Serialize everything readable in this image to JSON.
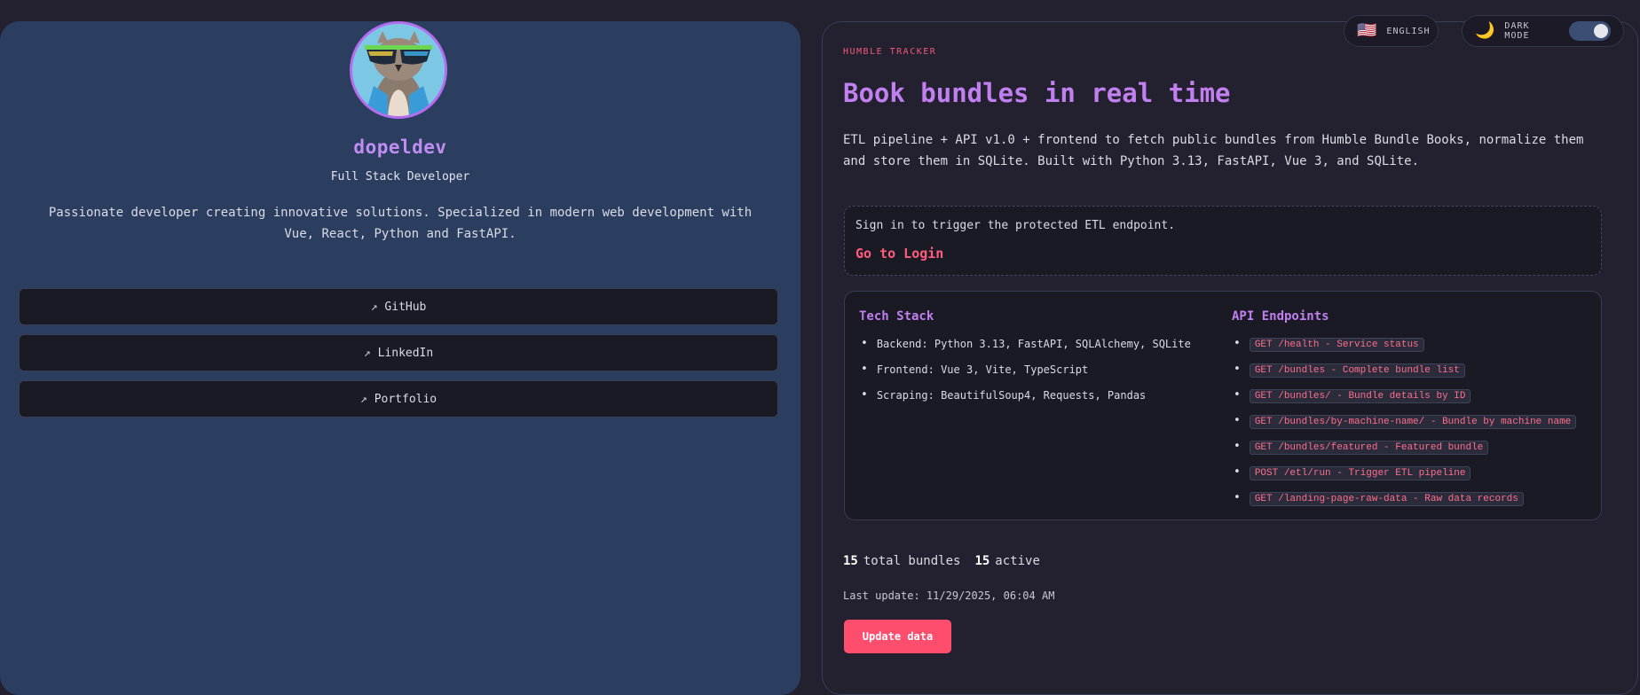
{
  "profile": {
    "name": "dopeldev",
    "role": "Full Stack Developer",
    "bio": "Passionate developer creating innovative solutions. Specialized in modern web development with Vue, React, Python and FastAPI.",
    "links": [
      {
        "label": "GitHub",
        "icon": "external-arrow-icon"
      },
      {
        "label": "LinkedIn",
        "icon": "external-arrow-icon"
      },
      {
        "label": "Portfolio",
        "icon": "external-arrow-icon"
      }
    ],
    "link_arrow": "↗"
  },
  "header": {
    "language_flag": "🇺🇸",
    "language_label": "ENGLISH",
    "theme_icon": "🌙",
    "theme_label": "DARK MODE",
    "dark_mode_on": true
  },
  "hero": {
    "eyebrow": "HUMBLE TRACKER",
    "title": "Book bundles in real time",
    "description": "ETL pipeline + API v1.0 + frontend to fetch public bundles from Humble Bundle Books, normalize them and store them in SQLite. Built with Python 3.13, FastAPI, Vue 3, and SQLite."
  },
  "login": {
    "message": "Sign in to trigger the protected ETL endpoint.",
    "link_label": "Go to Login"
  },
  "tech_stack": {
    "title": "Tech Stack",
    "items": [
      "Backend: Python 3.13, FastAPI, SQLAlchemy, SQLite",
      "Frontend: Vue 3, Vite, TypeScript",
      "Scraping: BeautifulSoup4, Requests, Pandas"
    ]
  },
  "api": {
    "title": "API Endpoints",
    "endpoints": [
      "GET /health - Service status",
      "GET /bundles - Complete bundle list",
      "GET /bundles/ - Bundle details by ID",
      "GET /bundles/by-machine-name/ - Bundle by machine name",
      "GET /bundles/featured - Featured bundle",
      "POST /etl/run - Trigger ETL pipeline",
      "GET /landing-page-raw-data - Raw data records"
    ]
  },
  "stats": {
    "total_count": "15",
    "total_label": "total bundles",
    "active_count": "15",
    "active_label": "active",
    "last_update": "Last update: 11/29/2025, 06:04 AM",
    "update_button": "Update data"
  },
  "colors": {
    "accent_purple": "#c17ff0",
    "accent_pink": "#ff4d6d",
    "left_panel_bg": "#2b3e60",
    "page_bg": "#23212f"
  }
}
